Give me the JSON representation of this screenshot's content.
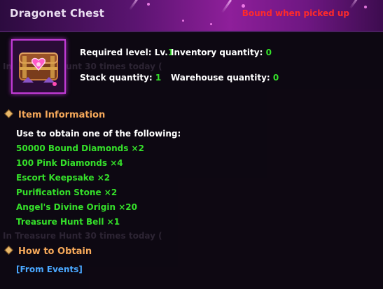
{
  "item": {
    "name": "Dragonet Chest",
    "bind_note": "Bound when picked up",
    "icon": "treasure-chest-icon"
  },
  "attributes": {
    "required_level_label": "Required level: Lv.",
    "required_level_value": "1",
    "inventory_label": "Inventory quantity: ",
    "inventory_value": "0",
    "stack_label": "Stack quantity: ",
    "stack_value": "1",
    "warehouse_label": "Warehouse quantity: ",
    "warehouse_value": "0"
  },
  "sections": {
    "item_info": {
      "title": "Item Information",
      "intro": "Use to obtain one of the following:",
      "rewards": [
        "50000 Bound Diamonds ×2",
        "100 Pink Diamonds ×4",
        "Escort Keepsake ×2",
        "Purification Stone ×2",
        "Angel's Divine Origin ×20",
        "Treasure Hunt Bell ×1"
      ]
    },
    "how_to_obtain": {
      "title": "How to Obtain",
      "source": "[From Events]"
    }
  },
  "background": {
    "ghost_line_1": "In Treasure Hunt 30 times today (",
    "ghost_line_2": "In Treasure Hunt 30 times today ("
  },
  "colors": {
    "title": "#e9ddf0",
    "bound": "#ff2a2a",
    "value_green": "#35e02a",
    "section_header": "#f6a95a",
    "link": "#4aa8ff",
    "frame": "#c23bd6"
  }
}
